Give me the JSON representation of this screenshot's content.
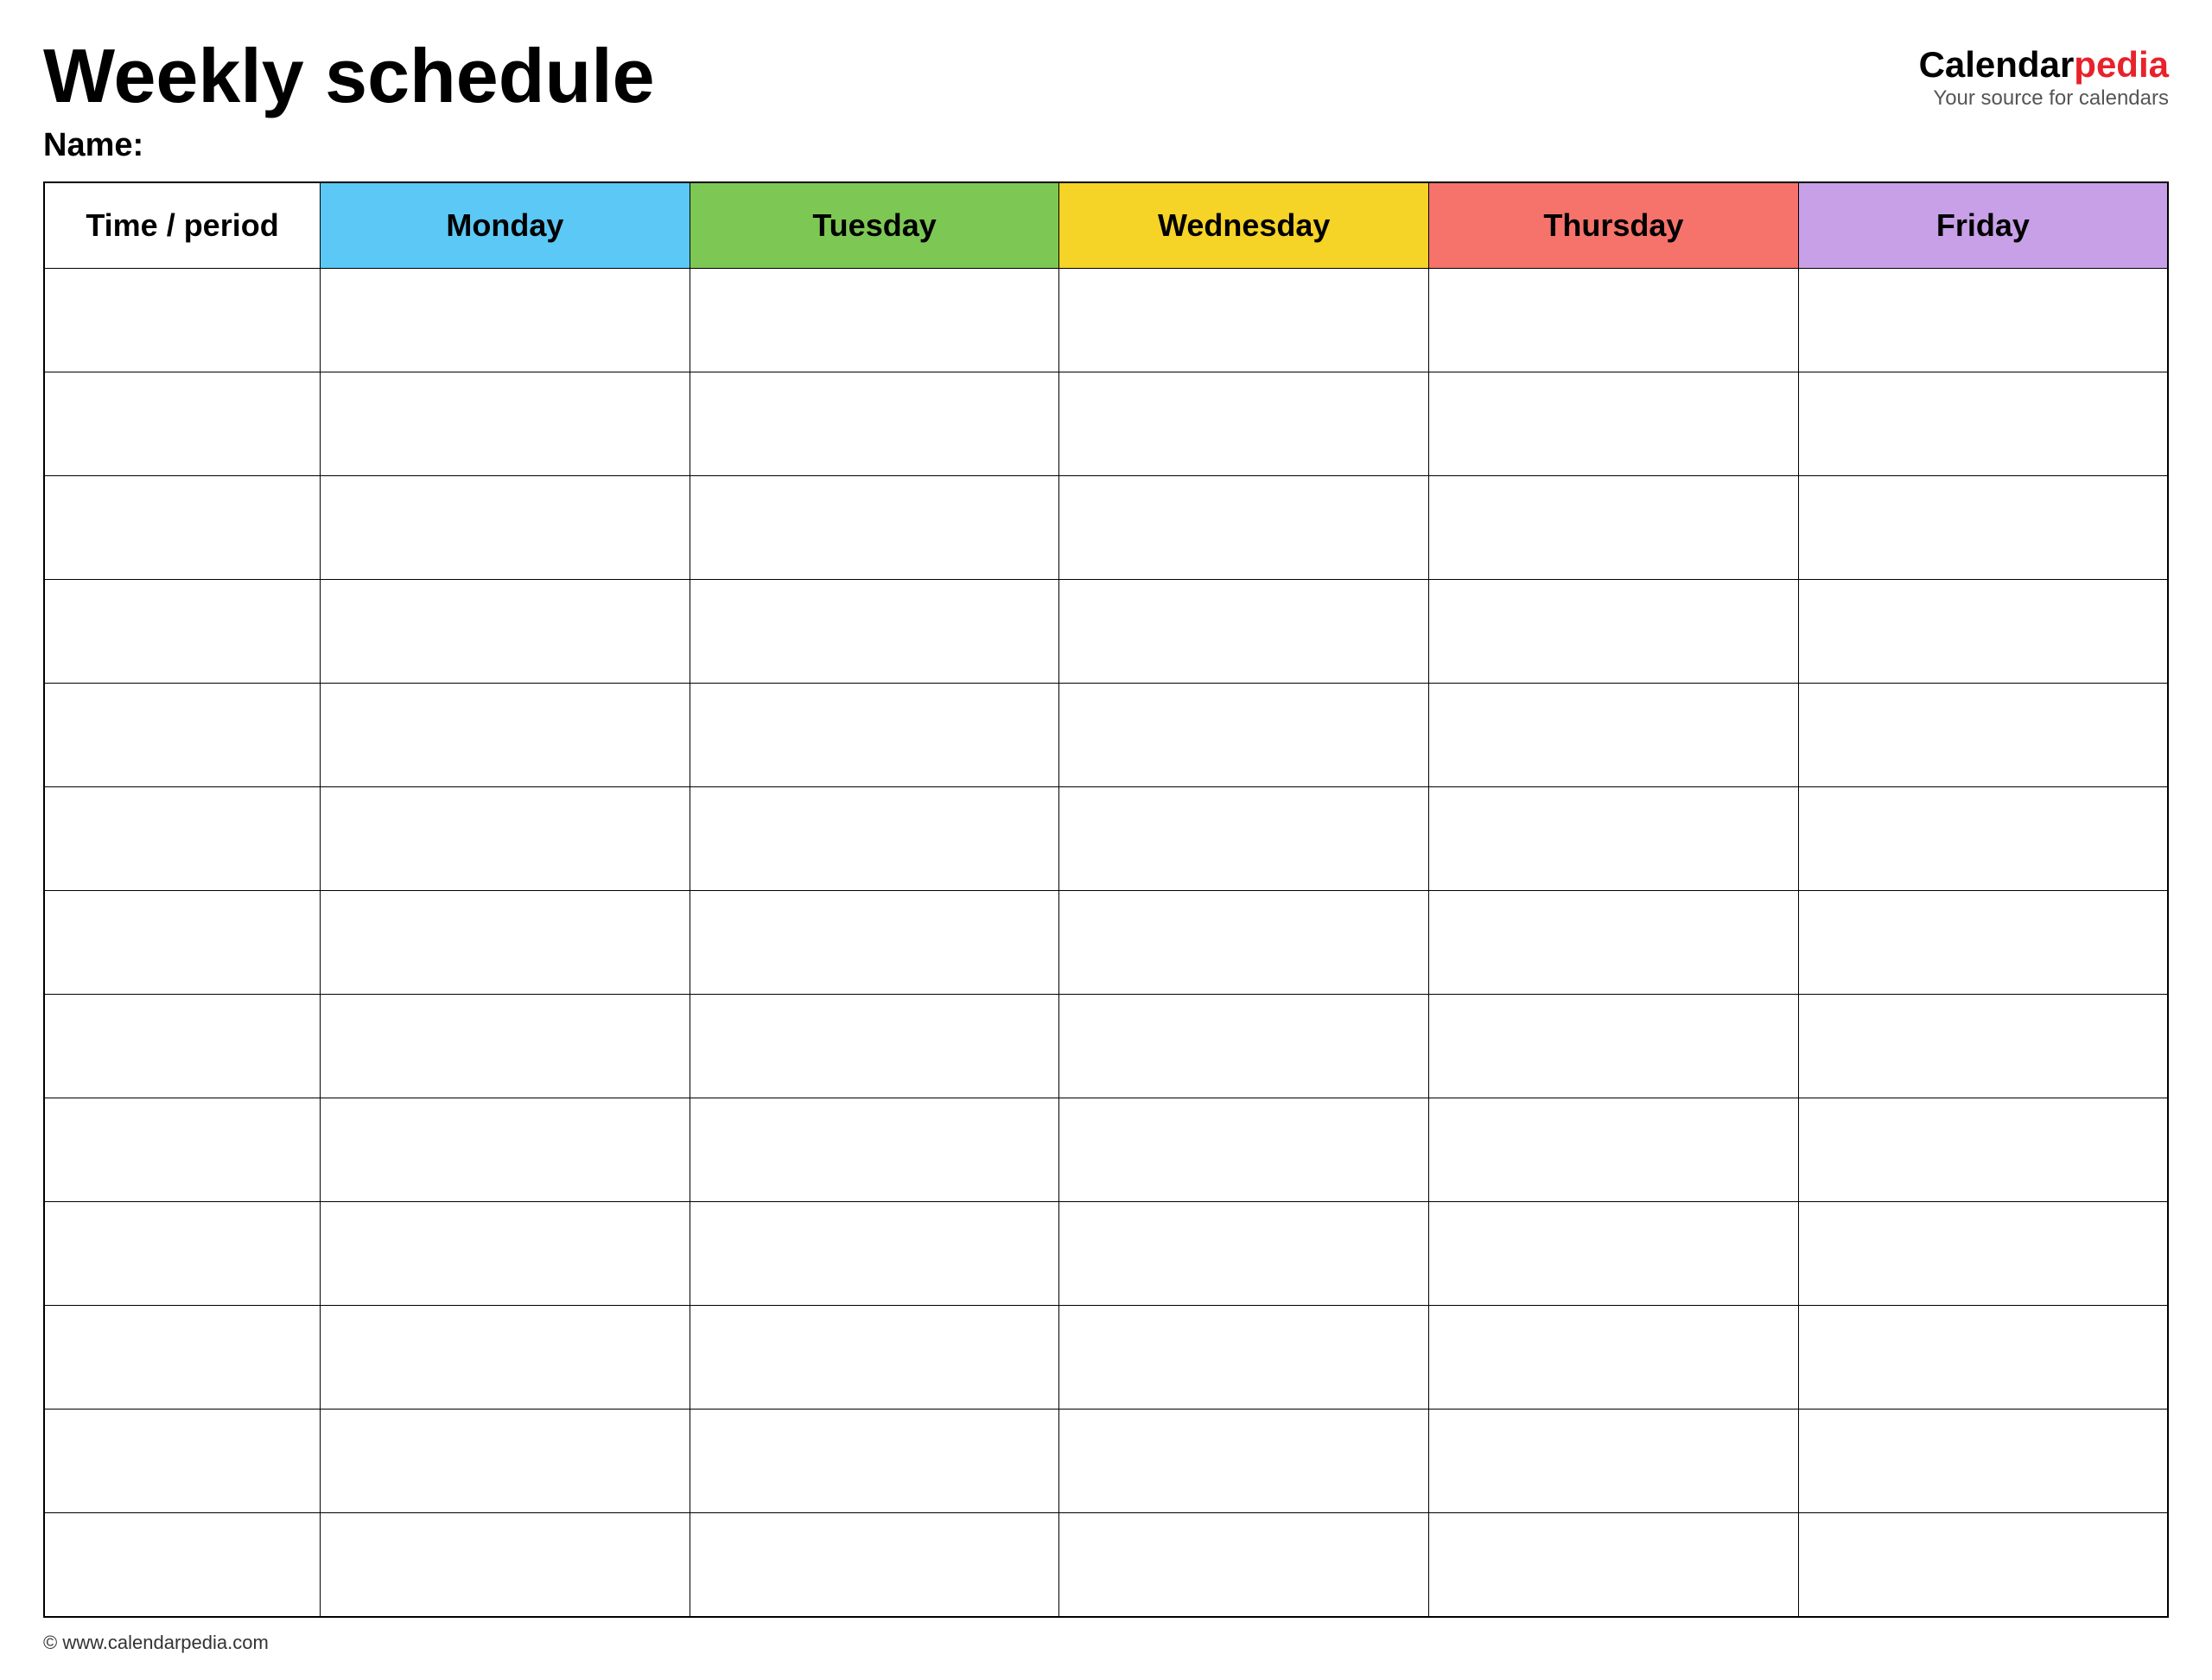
{
  "header": {
    "title": "Weekly schedule",
    "name_label": "Name:",
    "logo_calendar": "Calendar",
    "logo_pedia": "pedia",
    "logo_subtitle": "Your source for calendars",
    "footer_url": "© www.calendarpedia.com"
  },
  "table": {
    "columns": [
      {
        "id": "time",
        "label": "Time / period",
        "color_class": "col-time"
      },
      {
        "id": "monday",
        "label": "Monday",
        "color_class": "col-monday"
      },
      {
        "id": "tuesday",
        "label": "Tuesday",
        "color_class": "col-tuesday"
      },
      {
        "id": "wednesday",
        "label": "Wednesday",
        "color_class": "col-wednesday"
      },
      {
        "id": "thursday",
        "label": "Thursday",
        "color_class": "col-thursday"
      },
      {
        "id": "friday",
        "label": "Friday",
        "color_class": "col-friday"
      }
    ],
    "row_count": 13
  }
}
